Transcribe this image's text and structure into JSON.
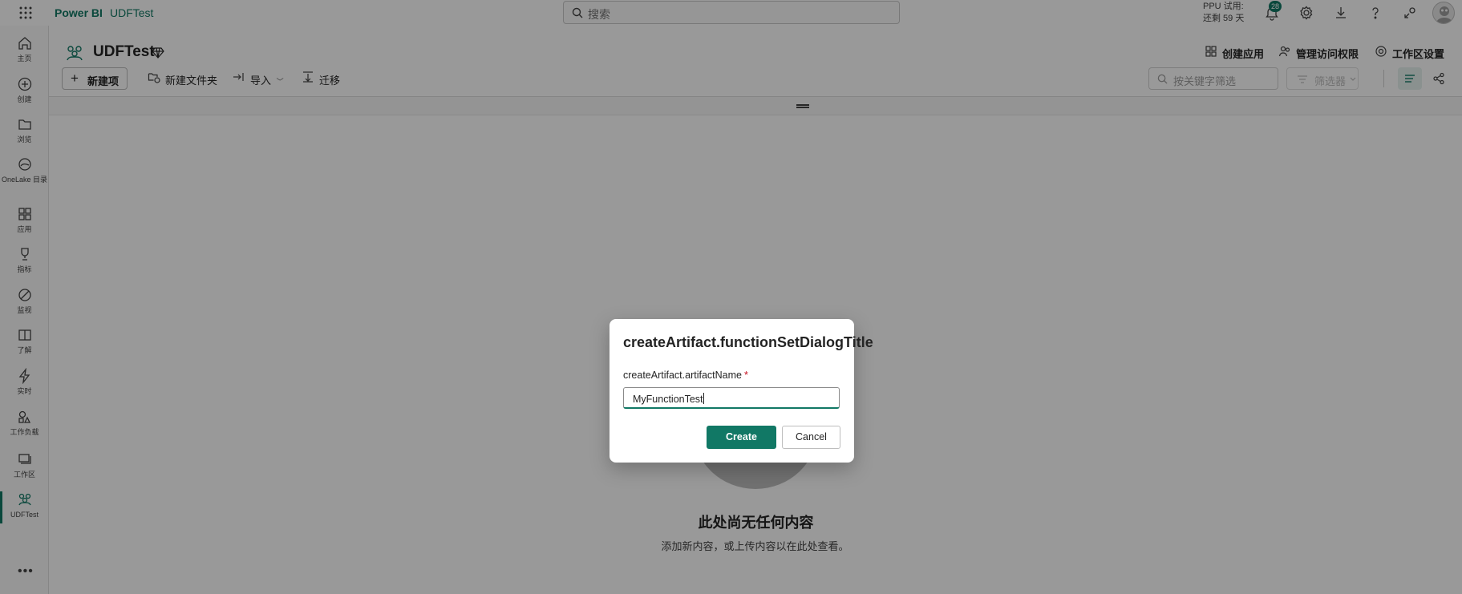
{
  "topbar": {
    "brand": "Power BI",
    "breadcrumb": "UDFTest",
    "search_placeholder": "搜索",
    "trial_line1": "PPU 试用:",
    "trial_line2": "还剩 59 天",
    "notification_count": "28"
  },
  "rail": {
    "items": [
      {
        "label": "主页",
        "icon": "home-icon"
      },
      {
        "label": "创建",
        "icon": "create-icon"
      },
      {
        "label": "浏览",
        "icon": "folder-icon"
      },
      {
        "label": "OneLake 目录",
        "icon": "onelake-icon"
      },
      {
        "label": "应用",
        "icon": "apps-icon"
      },
      {
        "label": "指标",
        "icon": "trophy-icon"
      },
      {
        "label": "监视",
        "icon": "monitor-icon"
      },
      {
        "label": "了解",
        "icon": "book-icon"
      },
      {
        "label": "实时",
        "icon": "lightning-icon"
      },
      {
        "label": "工作负载",
        "icon": "workloads-icon"
      },
      {
        "label": "工作区",
        "icon": "workspaces-icon"
      },
      {
        "label": "UDFTest",
        "icon": "workspace-udftest-icon"
      }
    ],
    "more": "•••"
  },
  "workspace": {
    "title": "UDFTest",
    "actions": {
      "create_app": "创建应用",
      "manage_access": "管理访问权限",
      "workspace_settings": "工作区设置"
    }
  },
  "commandbar": {
    "new_item": "新建项",
    "new_folder": "新建文件夹",
    "import": "导入",
    "migrate": "迁移",
    "filter_placeholder": "按关键字筛选",
    "filter_button": "筛选器"
  },
  "empty_state": {
    "title": "此处尚无任何内容",
    "subtitle": "添加新内容，或上传内容以在此处查看。"
  },
  "dialog": {
    "title": "createArtifact.functionSetDialogTitle",
    "field_label": "createArtifact.artifactName",
    "required_mark": "*",
    "field_value": "MyFunctionTest",
    "create_label": "Create",
    "cancel_label": "Cancel"
  },
  "colors": {
    "brand": "#117865",
    "required": "#c50f1f"
  }
}
